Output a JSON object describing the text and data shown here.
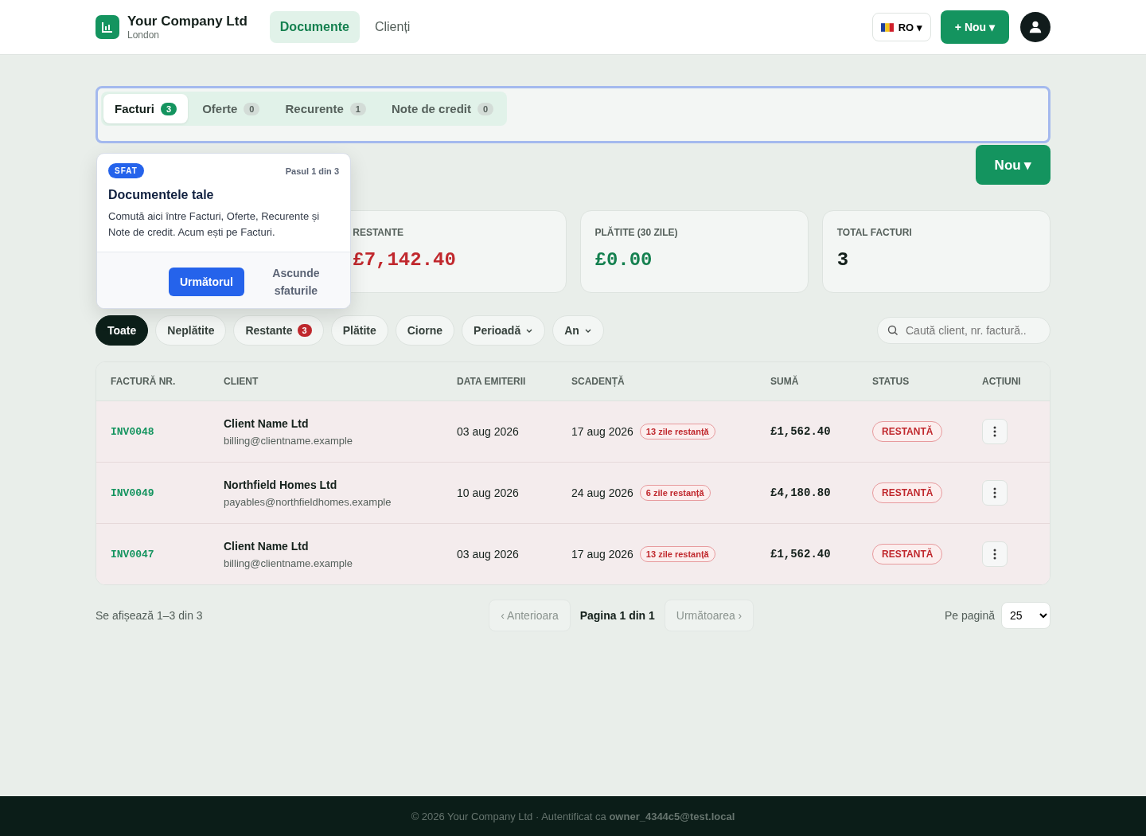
{
  "header": {
    "company": "Your Company Ltd",
    "location": "London",
    "nav": [
      {
        "label": "Documente",
        "selected": true
      },
      {
        "label": "Clienți",
        "selected": false
      }
    ],
    "language": "RO ▾",
    "new_button": "+ Nou ▾"
  },
  "doc_tabs": [
    {
      "label": "Facturi",
      "count": "3",
      "selected": true
    },
    {
      "label": "Oferte",
      "count": "0",
      "selected": false
    },
    {
      "label": "Recurente",
      "count": "1",
      "selected": false
    },
    {
      "label": "Note de credit",
      "count": "0",
      "selected": false
    }
  ],
  "page_new_button": "Nou ▾",
  "tour_popover": {
    "badge": "SFAT",
    "step": "Pasul 1 din 3",
    "title": "Documentele tale",
    "text": "Comută aici între Facturi, Oferte, Recurente și Note de credit. Acum ești pe Facturi.",
    "next_button": "Următorul",
    "hide_button": "Ascunde sfaturile"
  },
  "stats": [
    {
      "label": "RESTANTE",
      "value": "£7,142.40",
      "kind": "overdue"
    },
    {
      "label": "PLĂTITE (30 ZILE)",
      "value": "£0.00",
      "kind": "paid"
    },
    {
      "label": "TOTAL FACTURI",
      "value": "3",
      "kind": "count"
    }
  ],
  "filters": [
    {
      "label": "Toate",
      "kind": "chip",
      "selected": true
    },
    {
      "label": "Neplătite",
      "kind": "chip",
      "selected": false
    },
    {
      "label": "Restante",
      "kind": "chip",
      "selected": false,
      "count": "3"
    },
    {
      "label": "Plătite",
      "kind": "chip",
      "selected": false
    },
    {
      "label": "Ciorne",
      "kind": "chip",
      "selected": false
    },
    {
      "label": "Perioadă",
      "kind": "dropdown",
      "selected": false
    },
    {
      "label": "An",
      "kind": "dropdown",
      "selected": false
    }
  ],
  "search": {
    "placeholder": "Caută client, nr. factură.."
  },
  "table": {
    "columns": [
      "FACTURĂ NR.",
      "CLIENT",
      "DATA EMITERII",
      "SCADENȚĂ",
      "SUMĂ",
      "STATUS",
      "ACȚIUNI"
    ],
    "rows": [
      {
        "number": "INV0048",
        "client": "Client Name Ltd",
        "email": "billing@clientname.example",
        "issued": "03 aug 2026",
        "due": "17 aug 2026",
        "overdue": "13 zile restanță",
        "amount": "£1,562.40",
        "status": "RESTANTĂ",
        "kind": "overdue"
      },
      {
        "number": "INV0049",
        "client": "Northfield Homes Ltd",
        "email": "payables@northfieldhomes.example",
        "issued": "10 aug 2026",
        "due": "24 aug 2026",
        "overdue": "6 zile restanță",
        "amount": "£4,180.80",
        "status": "RESTANTĂ",
        "kind": "overdue"
      },
      {
        "number": "INV0047",
        "client": "Client Name Ltd",
        "email": "billing@clientname.example",
        "issued": "03 aug 2026",
        "due": "17 aug 2026",
        "overdue": "13 zile restanță",
        "amount": "£1,562.40",
        "status": "RESTANTĂ",
        "kind": "overdue"
      }
    ]
  },
  "pagination": {
    "summary": "Se afișează 1–3 din 3",
    "previous": "‹ Anterioara",
    "page": "Pagina 1 din 1",
    "next": "Următoarea ›",
    "previous_disabled": true,
    "next_disabled": true,
    "per_page_label": "Pe pagină",
    "per_page": "25"
  },
  "footer": "© 2026 Your Company Ltd · Autentificat ca **owner_4344c5@test.local**"
}
